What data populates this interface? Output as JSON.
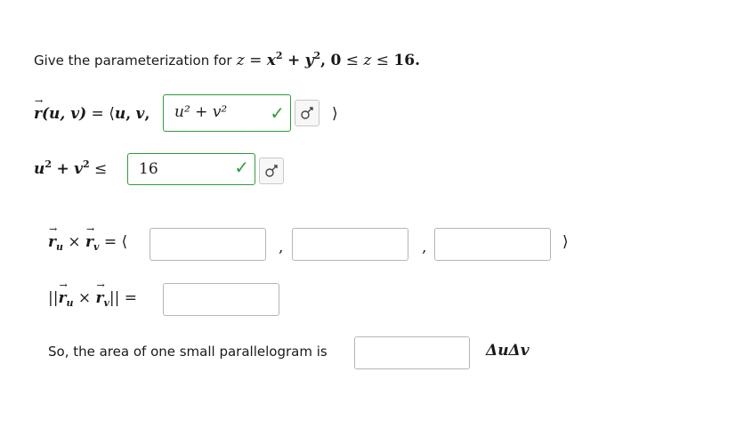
{
  "question": {
    "intro": "Give the parameterization for",
    "var_z": "z",
    "equals": "=",
    "x": "x",
    "plus": "+",
    "y": "y",
    "exp2": "2",
    "comma": ",",
    "zero": "0",
    "leq": "≤",
    "sixteen": "16",
    "period": "."
  },
  "row_r": {
    "vec_r": "r",
    "args": "(u, v)",
    "equals": "=",
    "open": "⟨",
    "u": "u",
    "comma": ",",
    "v": "v",
    "close": "⟩",
    "answer_value": "u² + v²",
    "correct_mark": "✓"
  },
  "row_domain": {
    "u": "u",
    "plus": "+",
    "v": "v",
    "exp2": "2",
    "leq": "≤",
    "answer_value": "16",
    "correct_mark": "✓"
  },
  "row_cross": {
    "vec_r": "r",
    "sub_u": "u",
    "times": "×",
    "sub_v": "v",
    "equals": "=",
    "open": "⟨",
    "comma": ",",
    "close": "⟩",
    "answer_values": [
      "",
      "",
      ""
    ]
  },
  "row_norm": {
    "bars_open": "||",
    "vec_r": "r",
    "sub_u": "u",
    "times": "×",
    "sub_v": "v",
    "bars_close": "||",
    "equals": "=",
    "answer_value": ""
  },
  "row_area": {
    "text": "So, the area of one small parallelogram is",
    "answer_value": "",
    "suffix": "ΔuΔv"
  },
  "icons": {
    "equation_editor": "equation-editor-icon"
  },
  "colors": {
    "correct": "#2e9e3a",
    "box_border": "#b5b5b5"
  }
}
